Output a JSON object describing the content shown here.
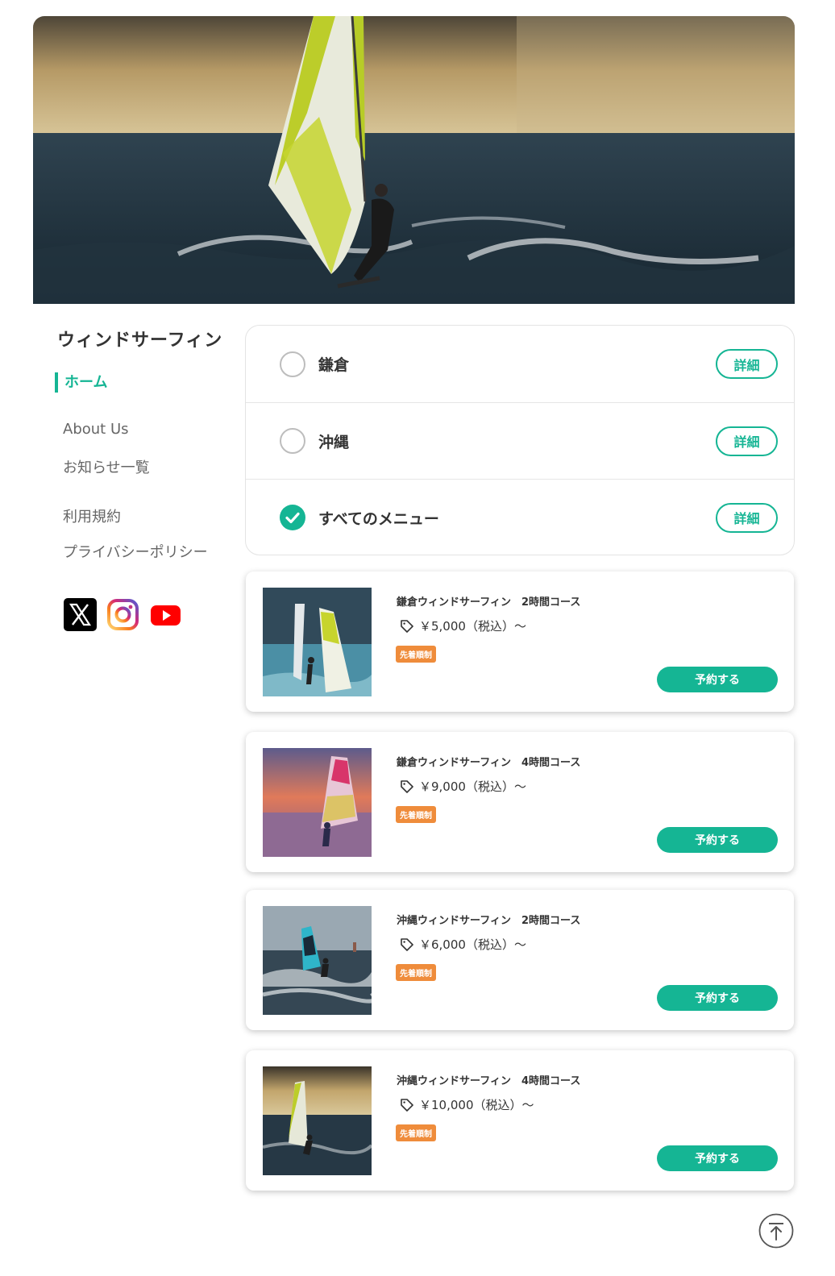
{
  "site": {
    "title": "ウィンドサーフィン"
  },
  "hero": {
    "image_alt": "ウィンドサーフィン"
  },
  "nav": {
    "home": "ホーム",
    "links": [
      "About Us",
      "お知らせ一覧",
      "利用規約",
      "プライバシーポリシー"
    ]
  },
  "social": [
    {
      "icon": "x-icon"
    },
    {
      "icon": "instagram-icon"
    },
    {
      "icon": "youtube-icon"
    }
  ],
  "categories": [
    {
      "label": "鎌倉",
      "selected": false,
      "detail": "詳細"
    },
    {
      "label": "沖縄",
      "selected": false,
      "detail": "詳細"
    },
    {
      "label": "すべてのメニュー",
      "selected": true,
      "detail": "詳細"
    }
  ],
  "courses": [
    {
      "title": "鎌倉ウィンドサーフィン　2時間コース",
      "price": "￥5,000（税込）〜",
      "badge": "先着順制",
      "button": "予約する"
    },
    {
      "title": "鎌倉ウィンドサーフィン　4時間コース",
      "price": "￥9,000（税込）〜",
      "badge": "先着順制",
      "button": "予約する"
    },
    {
      "title": "沖縄ウィンドサーフィン　2時間コース",
      "price": "￥6,000（税込）〜",
      "badge": "先着順制",
      "button": "予約する"
    },
    {
      "title": "沖縄ウィンドサーフィン　4時間コース",
      "price": "￥10,000（税込）〜",
      "badge": "先着順制",
      "button": "予約する"
    }
  ],
  "colors": {
    "accent": "#15b594",
    "badge": "#ef8c3b",
    "text": "#333333"
  }
}
